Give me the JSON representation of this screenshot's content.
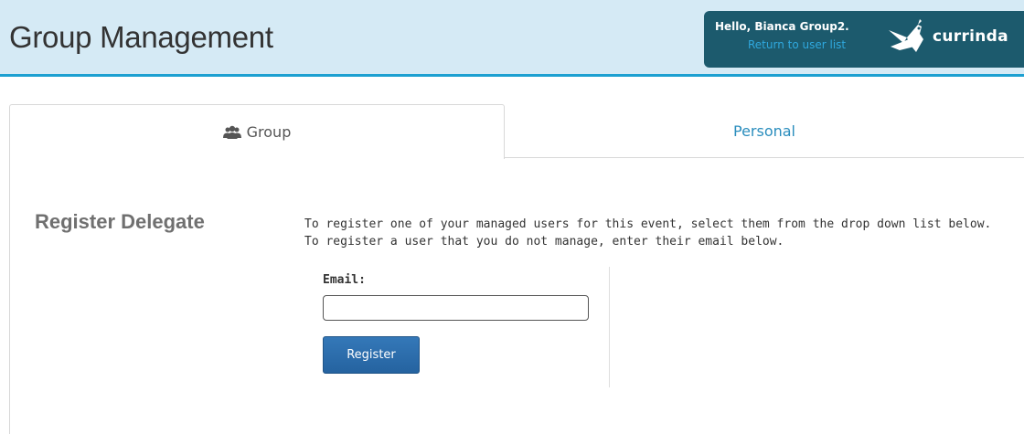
{
  "header": {
    "title": "Group Management",
    "greeting": "Hello, Bianca Group2.",
    "return_link": "Return to user list",
    "brand": "currinda",
    "brand_icon": "bird-logo-icon"
  },
  "tabs": [
    {
      "label": "Group",
      "icon": "users-icon",
      "active": true
    },
    {
      "label": "Personal",
      "active": false
    }
  ],
  "section": {
    "title": "Register Delegate",
    "instructions": "To register one of your managed users for this event, select them from the drop down list below. To register a user that you do not manage, enter their email below."
  },
  "form": {
    "email_label": "Email:",
    "email_value": "",
    "email_placeholder": "",
    "register_label": "Register"
  },
  "colors": {
    "header_bg": "#d5eaf5",
    "header_border": "#1da0d1",
    "user_box_bg": "#1c5a6d",
    "link": "#2a8dbd",
    "button": "#2a6aa6"
  }
}
